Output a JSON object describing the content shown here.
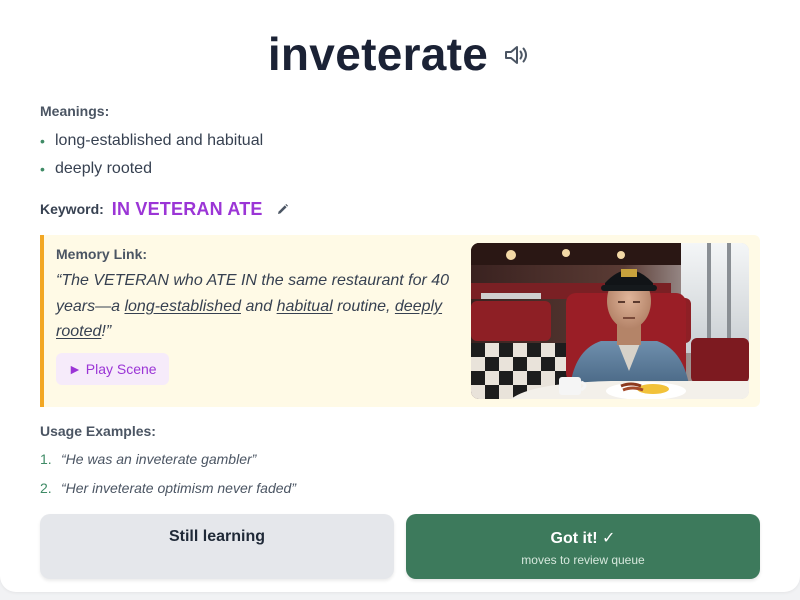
{
  "word": "inveterate",
  "meanings_label": "Meanings:",
  "meanings": [
    "long-established and habitual",
    "deeply rooted"
  ],
  "keyword": {
    "label": "Keyword:",
    "value": "IN VETERAN ATE"
  },
  "memory": {
    "label": "Memory Link:",
    "quote_open": "“The VETERAN who ATE IN the same restaurant for 40 years—a ",
    "term_1": "long-established",
    "join_1": " and ",
    "term_2": "habitual",
    "join_2": " routine, ",
    "term_3": "deeply rooted",
    "quote_close": "!”",
    "play_label": "► Play Scene",
    "image_alt": "Elderly veteran in a cap and denim jacket sitting at a diner booth with breakfast"
  },
  "usage": {
    "label": "Usage Examples:",
    "examples": [
      {
        "num": "1.",
        "text": "“He was an inveterate gambler”"
      },
      {
        "num": "2.",
        "text": "“Her inveterate optimism never faded”"
      }
    ]
  },
  "actions": {
    "still_learning": "Still learning",
    "got_it": "Got it! ✓",
    "got_it_sub": "moves to review queue"
  },
  "colors": {
    "keyword": "#9b35d6",
    "memory_bg": "#fffae6",
    "memory_accent": "#f2a724",
    "primary_green": "#3d7a5c"
  },
  "icons": {
    "speaker": "speaker-icon",
    "edit": "pencil-icon",
    "play": "play-icon",
    "check": "check-icon"
  }
}
